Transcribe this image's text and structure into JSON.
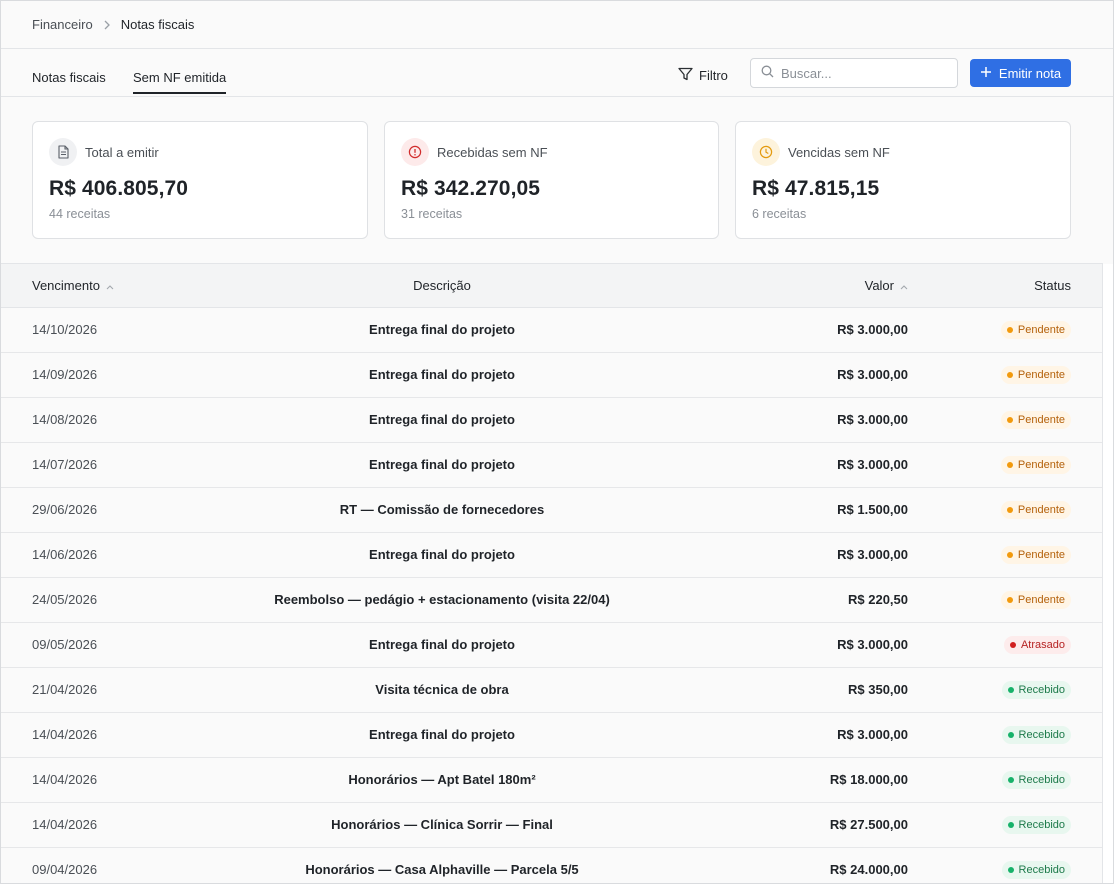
{
  "breadcrumb": {
    "parent": "Financeiro",
    "current": "Notas fiscais"
  },
  "tabs": [
    {
      "label": "Notas fiscais",
      "active": false
    },
    {
      "label": "Sem NF emitida",
      "active": true
    }
  ],
  "toolbar": {
    "filter_label": "Filtro",
    "search_placeholder": "Buscar...",
    "emit_label": "Emitir nota",
    "accent_color": "#2f6fe4"
  },
  "cards": [
    {
      "icon": "document-icon",
      "label": "Total a emitir",
      "value": "R$ 406.805,70",
      "sub": "44 receitas"
    },
    {
      "icon": "alert-circle-icon",
      "label": "Recebidas sem NF",
      "value": "R$ 342.270,05",
      "sub": "31 receitas"
    },
    {
      "icon": "clock-icon",
      "label": "Vencidas sem NF",
      "value": "R$ 47.815,15",
      "sub": "6 receitas"
    }
  ],
  "table": {
    "headers": {
      "vencimento": "Vencimento",
      "descricao": "Descrição",
      "valor": "Valor",
      "status": "Status"
    },
    "rows": [
      {
        "date": "14/10/2026",
        "desc": "Entrega final do projeto",
        "value": "R$ 3.000,00",
        "status": "Pendente"
      },
      {
        "date": "14/09/2026",
        "desc": "Entrega final do projeto",
        "value": "R$ 3.000,00",
        "status": "Pendente"
      },
      {
        "date": "14/08/2026",
        "desc": "Entrega final do projeto",
        "value": "R$ 3.000,00",
        "status": "Pendente"
      },
      {
        "date": "14/07/2026",
        "desc": "Entrega final do projeto",
        "value": "R$ 3.000,00",
        "status": "Pendente"
      },
      {
        "date": "29/06/2026",
        "desc": "RT — Comissão de fornecedores",
        "value": "R$ 1.500,00",
        "status": "Pendente"
      },
      {
        "date": "14/06/2026",
        "desc": "Entrega final do projeto",
        "value": "R$ 3.000,00",
        "status": "Pendente"
      },
      {
        "date": "24/05/2026",
        "desc": "Reembolso — pedágio + estacionamento (visita 22/04)",
        "value": "R$ 220,50",
        "status": "Pendente"
      },
      {
        "date": "09/05/2026",
        "desc": "Entrega final do projeto",
        "value": "R$ 3.000,00",
        "status": "Atrasado"
      },
      {
        "date": "21/04/2026",
        "desc": "Visita técnica de obra",
        "value": "R$ 350,00",
        "status": "Recebido"
      },
      {
        "date": "14/04/2026",
        "desc": "Entrega final do projeto",
        "value": "R$ 3.000,00",
        "status": "Recebido"
      },
      {
        "date": "14/04/2026",
        "desc": "Honorários — Apt Batel 180m²",
        "value": "R$ 18.000,00",
        "status": "Recebido"
      },
      {
        "date": "14/04/2026",
        "desc": "Honorários — Clínica Sorrir — Final",
        "value": "R$ 27.500,00",
        "status": "Recebido"
      },
      {
        "date": "09/04/2026",
        "desc": "Honorários — Casa Alphaville — Parcela 5/5",
        "value": "R$ 24.000,00",
        "status": "Recebido"
      }
    ]
  }
}
